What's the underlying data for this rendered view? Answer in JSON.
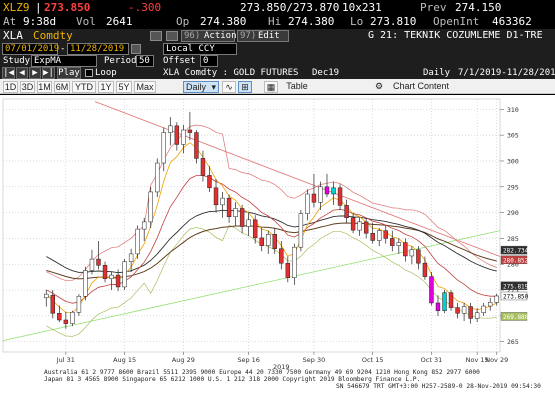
{
  "header": {
    "ticker": "XLZ9",
    "last": "273.850",
    "change": "-.300",
    "bid_ask": "273.850/273.870",
    "size": "10x231",
    "prev_label": "Prev",
    "prev": "274.150",
    "time_label": "At",
    "time": "9:38d",
    "vol_label": "Vol",
    "vol": "2641",
    "open_label": "Op",
    "open": "274.380",
    "hi_label": "Hi",
    "hi": "274.380",
    "lo_label": "Lo",
    "lo": "273.810",
    "oi_label": "OpenInt",
    "oi": "463362"
  },
  "toolbar": {
    "security": "XLA",
    "security_type": "Comdty",
    "actions_num": "96)",
    "actions_label": "Actions",
    "edit_num": "97)",
    "edit_label": "Edit",
    "screen_title": "G 21: TEKNIK COZUMLEME D1-TRE"
  },
  "range": {
    "start": "07/01/2019",
    "end": "11/28/2019",
    "currency": "Local CCY"
  },
  "study": {
    "study_label": "Study",
    "study": "ExpMA",
    "period_label": "Period",
    "period": "50",
    "offset_label": "Offset",
    "offset": "0",
    "play_label": "Play",
    "loop_label": "Loop",
    "security_name": "XLA  Comdty : GOLD FUTURES",
    "contract": "Dec19",
    "frequency": "Daily",
    "date_range": "7/1/2019-11/28/2019"
  },
  "periods": [
    "1D",
    "3D",
    "1M",
    "6M",
    "YTD",
    "1Y",
    "5Y",
    "Max"
  ],
  "frequency_select": "Daily",
  "table_label": "Table",
  "chart_content_label": "Chart Content",
  "footer": {
    "line1": "Australia 61 2 9777 8600 Brazil 5511 2395 9000 Europe 44 20 7330 7500 Germany 49 69 9204 1210 Hong Kong 852 2977 6000",
    "line2": "Japan 81 3 4565 8900        Singapore 65 6212 1000        U.S. 1 212 318 2000                    Copyright 2019 Bloomberg Finance L.P.",
    "line3": "SN 546679 TRT  GMT+3:00 H257-2589-0 28-Nov-2019 09:54:30"
  },
  "colors": {
    "amber": "#f0b400",
    "price_red": "#ff4040",
    "candle_up": "#ffffff",
    "candle_down": "#e03030",
    "highlight": "#e000e0",
    "highlight_up": "#00d0d0",
    "ema_short": "#f0a000",
    "ema_mid": "#c04040",
    "ema_long": "#303030",
    "ema_very_long": "#604020",
    "band": "#a8c060",
    "trend_red": "#e07070",
    "trend_green": "#90e070"
  },
  "chart_data": {
    "type": "candlestick",
    "x_tick_labels": [
      "Jul 31",
      "Aug 15",
      "Aug 29",
      "Sep 16",
      "Sep 30",
      "Oct 15",
      "Oct 31",
      "Nov 15",
      "Nov 29"
    ],
    "x_year_label": "2019",
    "y_tick_labels": [
      "265",
      "270",
      "275",
      "280",
      "285",
      "290",
      "295",
      "300",
      "305",
      "310"
    ],
    "ylim": [
      263,
      312
    ],
    "candles": [
      {
        "o": 273.5,
        "h": 275.0,
        "l": 271.8,
        "c": 274.2
      },
      {
        "o": 274.0,
        "h": 275.0,
        "l": 269.5,
        "c": 270.5
      },
      {
        "o": 270.5,
        "h": 272.0,
        "l": 268.8,
        "c": 269.2
      },
      {
        "o": 269.2,
        "h": 270.8,
        "l": 267.5,
        "c": 268.5
      },
      {
        "o": 268.5,
        "h": 271.0,
        "l": 268.0,
        "c": 270.7
      },
      {
        "o": 270.7,
        "h": 274.2,
        "l": 270.0,
        "c": 273.8
      },
      {
        "o": 273.8,
        "h": 279.5,
        "l": 273.0,
        "c": 278.8
      },
      {
        "o": 278.8,
        "h": 282.8,
        "l": 278.0,
        "c": 281.0
      },
      {
        "o": 281.0,
        "h": 284.5,
        "l": 279.0,
        "c": 279.8
      },
      {
        "o": 279.8,
        "h": 280.5,
        "l": 276.5,
        "c": 277.2
      },
      {
        "o": 277.2,
        "h": 278.5,
        "l": 275.0,
        "c": 277.9
      },
      {
        "o": 277.9,
        "h": 279.0,
        "l": 274.8,
        "c": 275.6
      },
      {
        "o": 275.6,
        "h": 281.0,
        "l": 275.0,
        "c": 280.5
      },
      {
        "o": 280.5,
        "h": 283.0,
        "l": 278.5,
        "c": 282.0
      },
      {
        "o": 282.0,
        "h": 287.5,
        "l": 281.0,
        "c": 286.8
      },
      {
        "o": 286.8,
        "h": 289.0,
        "l": 284.5,
        "c": 288.2
      },
      {
        "o": 288.2,
        "h": 295.0,
        "l": 287.0,
        "c": 294.0
      },
      {
        "o": 294.0,
        "h": 300.5,
        "l": 293.0,
        "c": 299.6
      },
      {
        "o": 299.6,
        "h": 306.5,
        "l": 298.0,
        "c": 305.5
      },
      {
        "o": 305.5,
        "h": 308.5,
        "l": 303.0,
        "c": 306.8
      },
      {
        "o": 306.8,
        "h": 307.5,
        "l": 302.0,
        "c": 303.2
      },
      {
        "o": 303.2,
        "h": 307.0,
        "l": 301.5,
        "c": 306.0
      },
      {
        "o": 306.0,
        "h": 309.5,
        "l": 304.0,
        "c": 305.5
      },
      {
        "o": 305.5,
        "h": 306.0,
        "l": 299.5,
        "c": 300.5
      },
      {
        "o": 300.5,
        "h": 302.0,
        "l": 296.0,
        "c": 297.2
      },
      {
        "o": 297.2,
        "h": 299.0,
        "l": 294.0,
        "c": 294.8
      },
      {
        "o": 294.8,
        "h": 296.5,
        "l": 290.0,
        "c": 291.5
      },
      {
        "o": 291.5,
        "h": 294.0,
        "l": 289.0,
        "c": 292.8
      },
      {
        "o": 292.8,
        "h": 293.5,
        "l": 288.0,
        "c": 289.2
      },
      {
        "o": 289.2,
        "h": 292.0,
        "l": 287.5,
        "c": 290.8
      },
      {
        "o": 290.8,
        "h": 291.5,
        "l": 286.0,
        "c": 287.3
      },
      {
        "o": 287.3,
        "h": 290.0,
        "l": 285.5,
        "c": 288.6
      },
      {
        "o": 288.6,
        "h": 289.5,
        "l": 284.0,
        "c": 285.1
      },
      {
        "o": 285.1,
        "h": 287.0,
        "l": 282.5,
        "c": 283.6
      },
      {
        "o": 283.6,
        "h": 286.5,
        "l": 282.0,
        "c": 285.8
      },
      {
        "o": 285.8,
        "h": 287.0,
        "l": 282.0,
        "c": 283.0
      },
      {
        "o": 283.0,
        "h": 284.5,
        "l": 279.0,
        "c": 280.2
      },
      {
        "o": 280.2,
        "h": 281.5,
        "l": 276.5,
        "c": 277.4
      },
      {
        "o": 277.4,
        "h": 284.0,
        "l": 276.0,
        "c": 283.3
      },
      {
        "o": 283.3,
        "h": 290.5,
        "l": 282.5,
        "c": 289.8
      },
      {
        "o": 289.8,
        "h": 294.5,
        "l": 288.5,
        "c": 293.6
      },
      {
        "o": 293.6,
        "h": 297.5,
        "l": 291.0,
        "c": 292.0
      },
      {
        "o": 292.0,
        "h": 296.0,
        "l": 290.5,
        "c": 295.0
      },
      {
        "o": 295.0,
        "h": 297.5,
        "l": 293.0,
        "c": 293.6,
        "hl": 1
      },
      {
        "o": 293.6,
        "h": 296.0,
        "l": 291.5,
        "c": 294.8,
        "hl": 2
      },
      {
        "o": 294.8,
        "h": 295.5,
        "l": 290.5,
        "c": 291.4
      },
      {
        "o": 291.4,
        "h": 292.5,
        "l": 288.0,
        "c": 289.0
      },
      {
        "o": 289.0,
        "h": 290.0,
        "l": 286.0,
        "c": 286.6
      },
      {
        "o": 286.6,
        "h": 289.0,
        "l": 285.5,
        "c": 288.2
      },
      {
        "o": 288.2,
        "h": 289.0,
        "l": 285.0,
        "c": 286.0
      },
      {
        "o": 286.0,
        "h": 288.0,
        "l": 284.0,
        "c": 284.6
      },
      {
        "o": 284.6,
        "h": 287.0,
        "l": 283.5,
        "c": 286.5
      },
      {
        "o": 286.5,
        "h": 287.5,
        "l": 284.0,
        "c": 285.0
      },
      {
        "o": 285.0,
        "h": 286.5,
        "l": 282.5,
        "c": 283.6
      },
      {
        "o": 283.6,
        "h": 285.0,
        "l": 282.0,
        "c": 284.2
      },
      {
        "o": 284.2,
        "h": 285.0,
        "l": 280.5,
        "c": 281.6
      },
      {
        "o": 281.6,
        "h": 283.5,
        "l": 280.0,
        "c": 282.8
      },
      {
        "o": 282.8,
        "h": 283.5,
        "l": 279.0,
        "c": 280.2
      },
      {
        "o": 280.2,
        "h": 281.5,
        "l": 277.0,
        "c": 277.6
      },
      {
        "o": 277.6,
        "h": 278.5,
        "l": 272.0,
        "c": 272.5,
        "hl": 1
      },
      {
        "o": 272.5,
        "h": 274.0,
        "l": 270.0,
        "c": 271.0,
        "hl": 1
      },
      {
        "o": 271.0,
        "h": 275.0,
        "l": 270.5,
        "c": 274.5,
        "hl": 2
      },
      {
        "o": 274.5,
        "h": 275.0,
        "l": 271.0,
        "c": 271.6
      },
      {
        "o": 271.6,
        "h": 272.5,
        "l": 269.5,
        "c": 270.5
      },
      {
        "o": 270.5,
        "h": 272.5,
        "l": 269.0,
        "c": 271.8
      },
      {
        "o": 271.8,
        "h": 272.5,
        "l": 268.5,
        "c": 269.5
      },
      {
        "o": 269.5,
        "h": 271.5,
        "l": 268.8,
        "c": 270.6
      },
      {
        "o": 270.6,
        "h": 272.5,
        "l": 270.0,
        "c": 271.9
      },
      {
        "o": 271.9,
        "h": 273.5,
        "l": 271.0,
        "c": 272.6
      },
      {
        "o": 272.6,
        "h": 274.3,
        "l": 272.0,
        "c": 273.85
      }
    ],
    "overlays": [
      {
        "name": "282.734",
        "value": 282.734,
        "color": "#303030"
      },
      {
        "name": "280.852",
        "value": 280.852,
        "color": "#c04040"
      },
      {
        "name": "275.819",
        "value": 275.819,
        "color": "#303030"
      },
      {
        "name": "273.850",
        "value": 273.85,
        "color": "#202020"
      },
      {
        "name": "269.888",
        "value": 269.888,
        "color": "#a8c060"
      }
    ]
  }
}
